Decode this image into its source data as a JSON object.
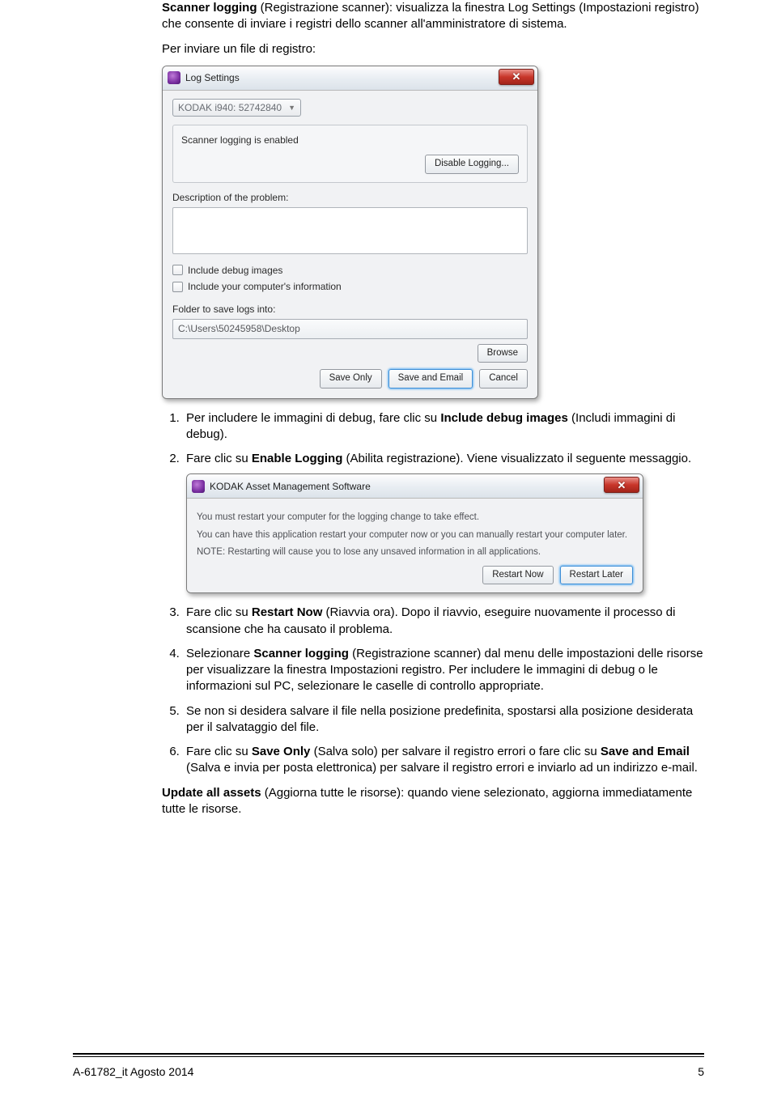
{
  "intro": {
    "bold": "Scanner logging",
    "rest": " (Registrazione scanner): visualizza la finestra Log Settings (Impostazioni registro) che consente di inviare i registri dello scanner all'amministratore di sistema."
  },
  "lead": "Per inviare un file di registro:",
  "win1": {
    "title": "Log Settings",
    "scanner": "KODAK i940: 52742840",
    "logging_status": "Scanner logging is enabled",
    "disable_btn": "Disable Logging...",
    "desc_label": "Description of the problem:",
    "cb_debug": "Include debug images",
    "cb_pc": "Include your computer's information",
    "folder_label": "Folder to save logs into:",
    "folder_path": "C:\\Users\\50245958\\Desktop",
    "browse": "Browse",
    "save_only": "Save Only",
    "save_email": "Save and Email",
    "cancel": "Cancel"
  },
  "steps": {
    "s1a": "Per includere le immagini di debug, fare clic su ",
    "s1b": "Include debug images",
    "s1c": " (Includi immagini di debug).",
    "s2a": "Fare clic su ",
    "s2b": "Enable Logging",
    "s2c": " (Abilita registrazione). Viene visualizzato il seguente messaggio."
  },
  "win2": {
    "title": "KODAK Asset Management Software",
    "l1": "You must restart your computer for the logging change to take effect.",
    "l2": "You can have this application restart your computer now or you can manually restart your computer later.",
    "l3": "NOTE: Restarting will cause you to lose any unsaved information in all applications.",
    "restart_now": "Restart Now",
    "restart_later": "Restart Later"
  },
  "steps2": {
    "s3a": "Fare clic su ",
    "s3b": "Restart Now",
    "s3c": " (Riavvia ora). Dopo il riavvio, eseguire nuovamente il processo di scansione che ha causato il problema.",
    "s4a": "Selezionare ",
    "s4b": "Scanner logging",
    "s4c": " (Registrazione scanner) dal menu delle impostazioni delle risorse per visualizzare la finestra Impostazioni registro. Per includere le immagini di debug o le informazioni sul PC, selezionare le caselle di controllo appropriate.",
    "s5": "Se non si desidera salvare il file nella posizione predefinita, spostarsi alla posizione desiderata per il salvataggio del file.",
    "s6a": "Fare clic su ",
    "s6b": "Save Only",
    "s6c": " (Salva solo) per salvare il registro errori o fare clic su ",
    "s6d": "Save and Email",
    "s6e": " (Salva e invia per posta elettronica) per salvare il registro errori e inviarlo ad un indirizzo e-mail."
  },
  "outro": {
    "bold": "Update all assets",
    "rest": " (Aggiorna tutte le risorse): quando viene selezionato, aggiorna immediatamente tutte le risorse."
  },
  "footer": {
    "left": "A-61782_it  Agosto 2014",
    "right": "5"
  }
}
